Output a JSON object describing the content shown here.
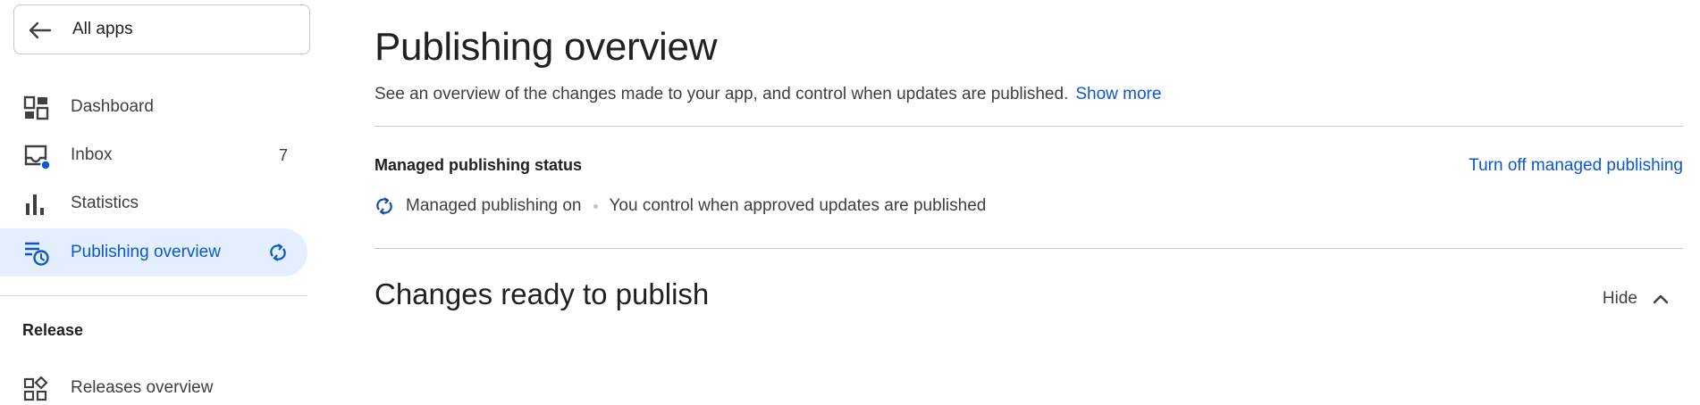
{
  "sidebar": {
    "back_label": "All apps",
    "items": [
      {
        "label": "Dashboard",
        "icon": "dashboard-icon"
      },
      {
        "label": "Inbox",
        "icon": "inbox-icon",
        "count": "7"
      },
      {
        "label": "Statistics",
        "icon": "bar-chart-icon"
      },
      {
        "label": "Publishing overview",
        "icon": "publishing-overview-icon",
        "trailing_icon": "sync-icon",
        "active": true
      }
    ],
    "section": {
      "title": "Release",
      "items": [
        {
          "label": "Releases overview",
          "icon": "releases-overview-icon"
        }
      ]
    }
  },
  "main": {
    "title": "Publishing overview",
    "description": "See an overview of the changes made to your app, and control when updates are published.",
    "show_more": "Show more",
    "managed": {
      "title": "Managed publishing status",
      "action": "Turn off managed publishing",
      "status": "Managed publishing on",
      "detail": "You control when approved updates are published"
    },
    "changes": {
      "title": "Changes ready to publish",
      "toggle": "Hide"
    }
  },
  "colors": {
    "accent": "#0b57d0",
    "active_bg": "#e3effd",
    "text": "#202124",
    "muted_text": "#3c4043",
    "divider": "#c4c7c5"
  }
}
